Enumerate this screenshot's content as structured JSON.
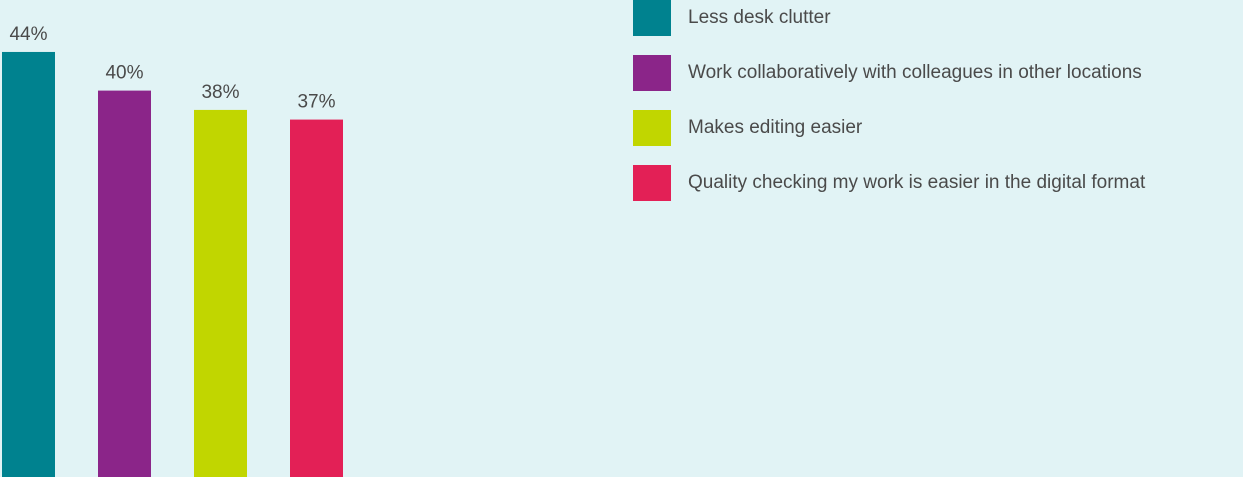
{
  "chart_data": {
    "type": "bar",
    "categories": [
      "Less desk clutter",
      "Work collaboratively with colleagues in other locations",
      "Makes editing easier",
      "Quality checking my work is easier in the digital format"
    ],
    "values": [
      44,
      40,
      38,
      37
    ],
    "value_labels": [
      "44%",
      "40%",
      "38%",
      "37%"
    ],
    "colors": [
      "#00828f",
      "#8b2589",
      "#c1d600",
      "#e32056"
    ],
    "title": "",
    "xlabel": "",
    "ylabel": "",
    "unit": "%",
    "grid": false,
    "legend_position": "top-right"
  }
}
